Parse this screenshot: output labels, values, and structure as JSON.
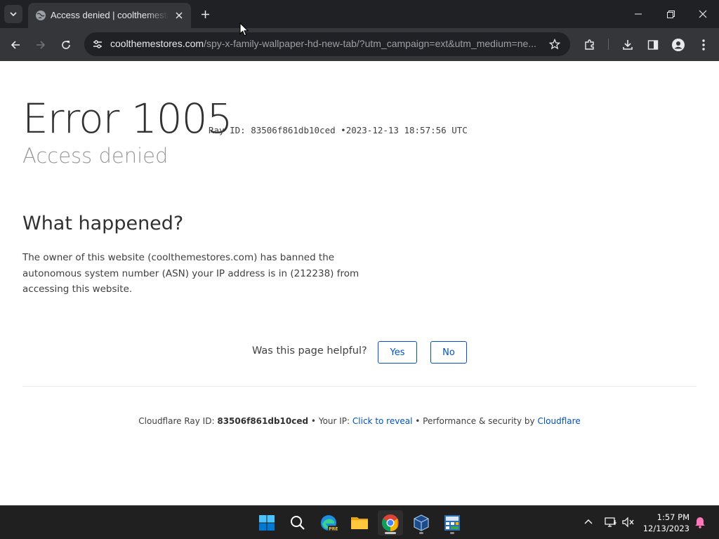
{
  "browser": {
    "tab_title": "Access denied | coolthemestores.com | Cloudflare",
    "url_host": "coolthemestores.com",
    "url_path": "/spy-x-family-wallpaper-hd-new-tab/?utm_campaign=ext&utm_medium=ne..."
  },
  "page": {
    "error_title": "Error 1005",
    "ray_label": "Ray ID: 83506f861db10ced",
    "separator": "•",
    "timestamp": "2023-12-13 18:57:56 UTC",
    "subtitle": "Access denied",
    "what_heading": "What happened?",
    "what_text": "The owner of this website (coolthemestores.com) has banned the autonomous system number (ASN) your IP address is in (212238) from accessing this website.",
    "helpful_question": "Was this page helpful?",
    "yes_label": "Yes",
    "no_label": "No"
  },
  "footer": {
    "ray_prefix": "Cloudflare Ray ID:",
    "ray_id": "83506f861db10ced",
    "sep1": "•",
    "ip_prefix": "Your IP:",
    "ip_link": "Click to reveal",
    "sep2": "•",
    "perf_text": "Performance & security by",
    "cloudflare_link": "Cloudflare"
  },
  "taskbar": {
    "time": "1:57 PM",
    "date": "12/13/2023",
    "apps": [
      "start-icon",
      "search-icon",
      "edge-icon",
      "file-explorer-icon",
      "chrome-icon",
      "virtualbox-icon",
      "calculator-app-icon"
    ]
  },
  "colors": {
    "link": "#0051c3",
    "chrome_dark": "#202124",
    "toolbar": "#35363a",
    "taskbar": "#202020"
  }
}
